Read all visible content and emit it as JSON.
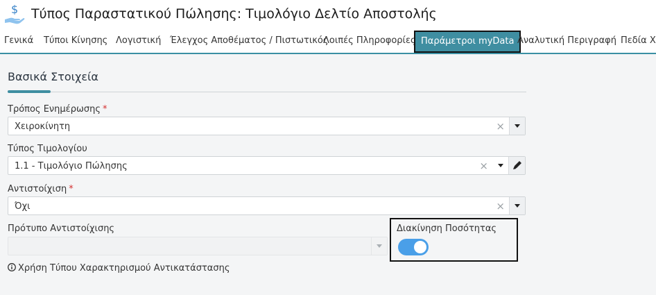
{
  "header": {
    "title": "Τύπος Παραστατικού Πώλησης: Τιμολόγιο Δελτίο Αποστολής",
    "icon": "hand-money-icon"
  },
  "tabs": [
    {
      "label": "Γενικά",
      "active": false
    },
    {
      "label": "Τύποι Κίνησης",
      "active": false
    },
    {
      "label": "Λογιστική",
      "active": false
    },
    {
      "label": "Έλεγχος Αποθέματος / Πιστωτικός",
      "active": false
    },
    {
      "label": "Λοιπές Πληροφορίες",
      "active": false
    },
    {
      "label": "Παράμετροι myData",
      "active": true
    },
    {
      "label": "Αναλυτική Περιγραφή",
      "active": false
    },
    {
      "label": "Πεδία Χρ",
      "active": false
    }
  ],
  "section": {
    "title": "Βασικά Στοιχεία"
  },
  "fields": {
    "update_method": {
      "label": "Τρόπος Ενημέρωσης",
      "required_mark": "*",
      "value": "Χειροκίνητη"
    },
    "invoice_type": {
      "label": "Τύπος Τιμολογίου",
      "value": "1.1 - Τιμολόγιο Πώλησης"
    },
    "mapping": {
      "label": "Αντιστοίχιση",
      "required_mark": "*",
      "value": "Όχι"
    },
    "mapping_template": {
      "label": "Πρότυπο Αντιστοίχισης",
      "value": ""
    }
  },
  "quantity_movement": {
    "label": "Διακίνηση Ποσότητας",
    "enabled": true
  },
  "info": {
    "text": "Χρήση Τύπου Χαρακτηρισμού Αντικατάστασης"
  },
  "colors": {
    "accent": "#3f8ea1",
    "toggle_on": "#4a9fe8",
    "required": "#d32f2f"
  }
}
